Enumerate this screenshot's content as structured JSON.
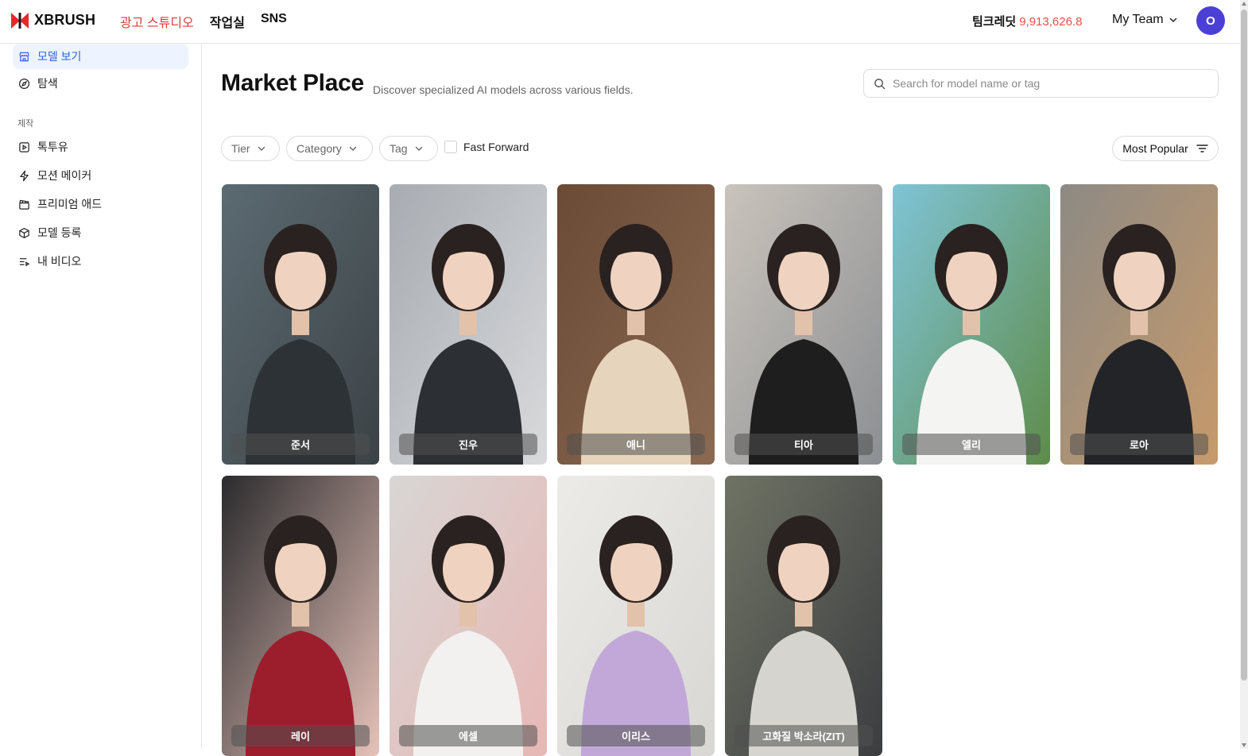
{
  "brand": {
    "name": "XBRUSH",
    "accent": "#e03a3a"
  },
  "topnav": {
    "items": [
      "광고 스튜디오",
      "작업실",
      "SNS"
    ],
    "active": 0
  },
  "account": {
    "credit_label": "팀크레딧",
    "credit_value": "9,913,626.8",
    "team_label": "My Team",
    "avatar_initial": "O",
    "avatar_color": "#4c3fd6"
  },
  "sidebar": {
    "items": [
      {
        "label": "모델 보기",
        "icon": "store-icon",
        "active": true
      },
      {
        "label": "탐색",
        "icon": "compass-icon"
      }
    ],
    "section_label": "제작",
    "section_items": [
      {
        "label": "톡투유",
        "icon": "play-square-icon"
      },
      {
        "label": "모션 메이커",
        "icon": "bolt-icon"
      },
      {
        "label": "프리미엄 애드",
        "icon": "clapper-icon"
      },
      {
        "label": "모델 등록",
        "icon": "cube-icon"
      },
      {
        "label": "내 비디오",
        "icon": "list-video-icon"
      }
    ]
  },
  "main": {
    "title": "Market Place",
    "subtitle": "Discover specialized AI models across various fields.",
    "search_placeholder": "Search for model name or tag",
    "filters": [
      "Tier",
      "Category",
      "Tag"
    ],
    "fast_forward_label": "Fast Forward",
    "sort_label": "Most Popular"
  },
  "models": [
    {
      "name": "준서",
      "palette": [
        "#5b6b72",
        "#2d3236",
        "#3c4246"
      ]
    },
    {
      "name": "진우",
      "palette": [
        "#a7acb2",
        "#2c2f33",
        "#d9dadc"
      ]
    },
    {
      "name": "애니",
      "palette": [
        "#6b4a36",
        "#e7d4bd",
        "#8b6a52"
      ]
    },
    {
      "name": "티아",
      "palette": [
        "#c9c3bb",
        "#1e1e1e",
        "#8c8f93"
      ]
    },
    {
      "name": "엘리",
      "palette": [
        "#7fc4d6",
        "#f4f4f2",
        "#5f8c4a"
      ]
    },
    {
      "name": "로아",
      "palette": [
        "#8d8a84",
        "#232427",
        "#c79a6b"
      ]
    },
    {
      "name": "레이",
      "palette": [
        "#2b2b2d",
        "#9c1e2d",
        "#e6c2b9"
      ]
    },
    {
      "name": "에셀",
      "palette": [
        "#d8d6d4",
        "#f2f1ef",
        "#e7b7b5"
      ]
    },
    {
      "name": "이리스",
      "palette": [
        "#ecebe8",
        "#c2a8d8",
        "#d8d7d4"
      ]
    },
    {
      "name": "고화질 박소라(ZIT)",
      "palette": [
        "#6f7364",
        "#d6d4ce",
        "#3b3d40"
      ]
    }
  ]
}
